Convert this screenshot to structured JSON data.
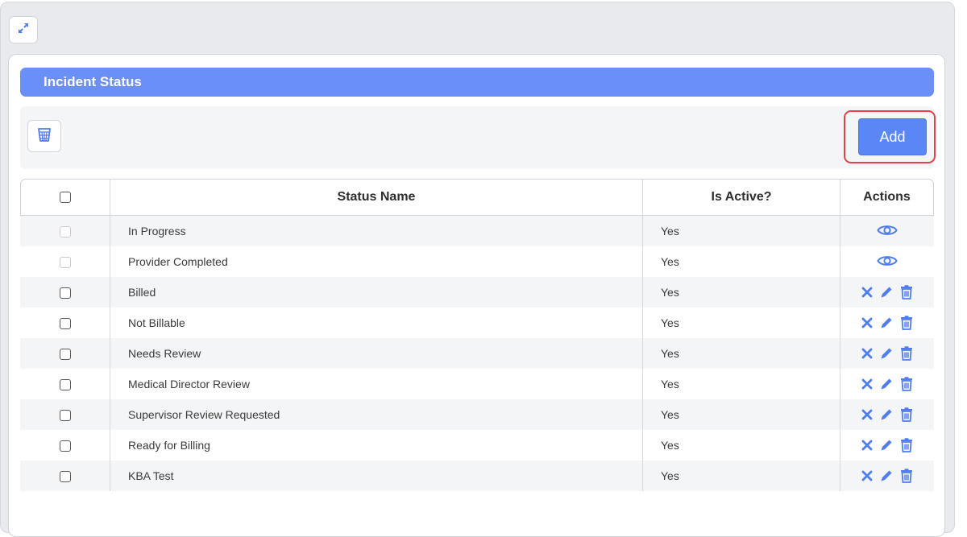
{
  "card": {
    "title": "Incident Status"
  },
  "toolbar": {
    "add_label": "Add"
  },
  "table": {
    "columns": {
      "status_name": "Status Name",
      "is_active": "Is Active?",
      "actions": "Actions"
    },
    "rows": [
      {
        "name": "In Progress",
        "active": "Yes",
        "editable": false
      },
      {
        "name": "Provider Completed",
        "active": "Yes",
        "editable": false
      },
      {
        "name": "Billed",
        "active": "Yes",
        "editable": true
      },
      {
        "name": "Not Billable",
        "active": "Yes",
        "editable": true
      },
      {
        "name": "Needs Review",
        "active": "Yes",
        "editable": true
      },
      {
        "name": "Medical Director Review",
        "active": "Yes",
        "editable": true
      },
      {
        "name": "Supervisor Review Requested",
        "active": "Yes",
        "editable": true
      },
      {
        "name": "Ready for Billing",
        "active": "Yes",
        "editable": true
      },
      {
        "name": "KBA Test",
        "active": "Yes",
        "editable": true
      }
    ]
  },
  "colors": {
    "accent": "#6a90f8",
    "button": "#5b86f5",
    "icon": "#4f7cf0",
    "highlight": "#e0434b"
  },
  "icons": {
    "expand": "expand-arrows-icon",
    "bulk_delete": "trash-bin-icon",
    "view": "eye-icon",
    "deactivate": "x-icon",
    "edit": "pencil-icon",
    "delete": "trash-icon"
  }
}
